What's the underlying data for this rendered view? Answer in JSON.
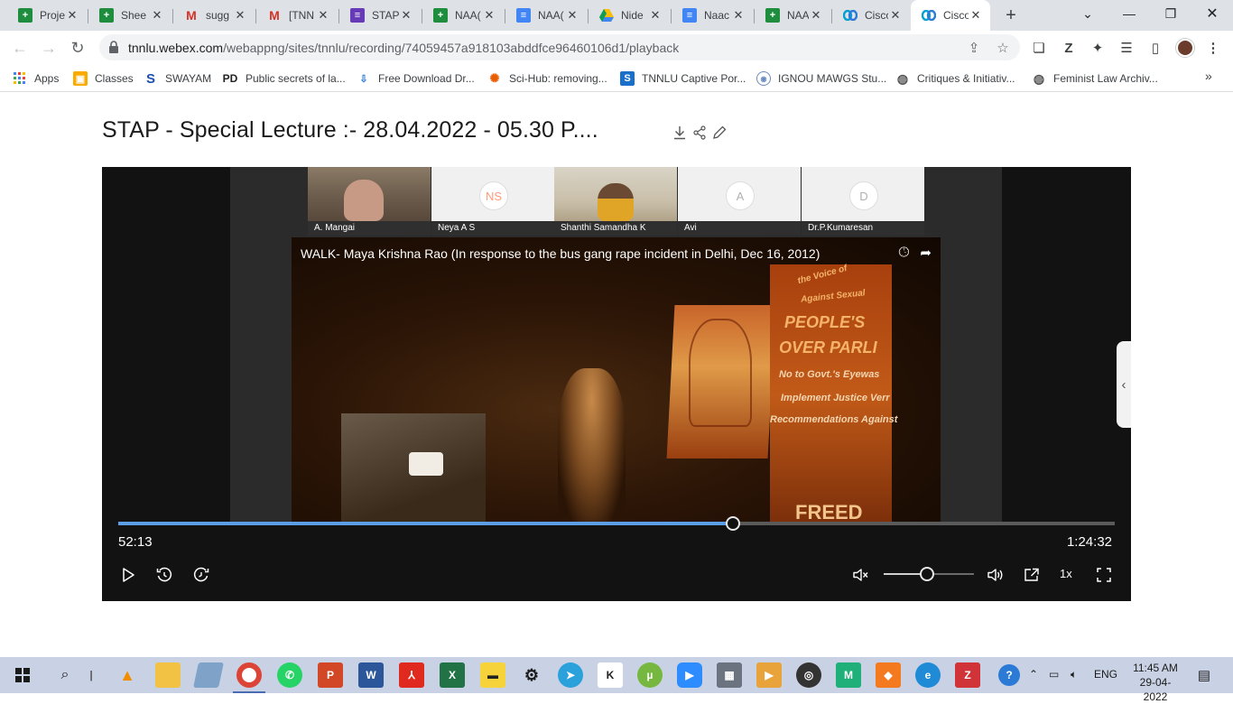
{
  "browser": {
    "tabs": [
      {
        "title": "Proje",
        "favicon": "sheets-icon",
        "active": false
      },
      {
        "title": "Shee",
        "favicon": "sheets-icon",
        "active": false
      },
      {
        "title": "sugg",
        "favicon": "gmail-icon",
        "active": false
      },
      {
        "title": "[TNN",
        "favicon": "gmail-icon",
        "active": false
      },
      {
        "title": "STAP",
        "favicon": "forms-icon",
        "active": false
      },
      {
        "title": "NAA(",
        "favicon": "sheets-icon",
        "active": false
      },
      {
        "title": "NAA(",
        "favicon": "docs-icon",
        "active": false
      },
      {
        "title": "Nide",
        "favicon": "drive-icon",
        "active": false
      },
      {
        "title": "Naac",
        "favicon": "docs-icon",
        "active": false
      },
      {
        "title": "NAA(",
        "favicon": "sheets-icon",
        "active": false
      },
      {
        "title": "Cisco",
        "favicon": "webex-icon",
        "active": false
      },
      {
        "title": "Cisco",
        "favicon": "webex-icon",
        "active": true
      }
    ],
    "address": {
      "host": "tnnlu.webex.com",
      "path": "/webappng/sites/tnnlu/recording/74059457a918103abddfce96460106d1/playback"
    },
    "bookmarks": [
      {
        "label": "Apps",
        "icon": "apps-grid-icon"
      },
      {
        "label": "Classes",
        "icon": "classroom-icon"
      },
      {
        "label": "SWAYAM",
        "icon": "swayam-icon"
      },
      {
        "label": "Public secrets of la...",
        "icon": "pd-icon"
      },
      {
        "label": "Free Download Dr...",
        "icon": "download-icon"
      },
      {
        "label": "Sci-Hub: removing...",
        "icon": "scihub-icon"
      },
      {
        "label": "TNNLU Captive Por...",
        "icon": "captive-portal-icon"
      },
      {
        "label": "IGNOU MAWGS Stu...",
        "icon": "ignou-icon"
      },
      {
        "label": "Critiques & Initiativ...",
        "icon": "globe-icon"
      },
      {
        "label": "Feminist Law Archiv...",
        "icon": "globe-icon"
      }
    ]
  },
  "page": {
    "title": "STAP - Special Lecture :- 28.04.2022 - 05.30 P...."
  },
  "player": {
    "participants": [
      {
        "name": "A. Mangai",
        "initials": "",
        "has_video": true
      },
      {
        "name": "Neya A S",
        "initials": "NS",
        "has_video": false
      },
      {
        "name": "Shanthi Samandha K",
        "initials": "",
        "has_video": true
      },
      {
        "name": "Avi",
        "initials": "A",
        "has_video": false
      },
      {
        "name": "Dr.P.Kumaresan",
        "initials": "D",
        "has_video": false
      }
    ],
    "shared_video_title": "WALK- Maya Krishna Rao (In response to the bus gang rape incident in Delhi, Dec 16, 2012)",
    "banner_lines": [
      "the Voice of",
      "Against Sexual",
      "PEOPLE'S",
      "OVER PARLI",
      "No to Govt.'s Eyewas",
      "Implement Justice Verr",
      "Recommendations Against",
      "FREED"
    ],
    "current_time": "52:13",
    "total_time": "1:24:32",
    "progress_fraction": 0.617,
    "volume_fraction": 0.48,
    "speed": "1x"
  },
  "taskbar": {
    "language": "ENG",
    "time": "11:45 AM",
    "date": "29-04-2022"
  }
}
